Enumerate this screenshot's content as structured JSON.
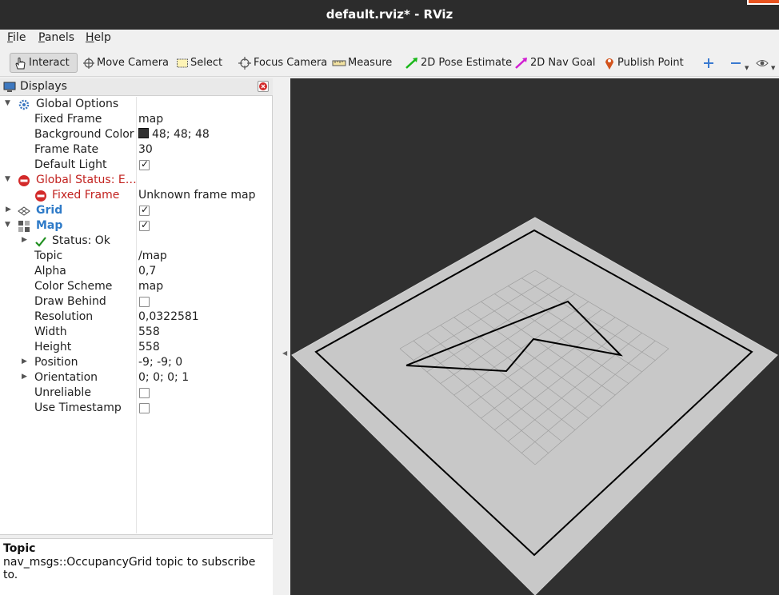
{
  "window": {
    "title": "default.rviz* - RViz"
  },
  "menu": [
    {
      "u": "F",
      "rest": "ile"
    },
    {
      "u": "P",
      "rest": "anels"
    },
    {
      "u": "H",
      "rest": "elp"
    }
  ],
  "toolbar": {
    "interact": "Interact",
    "move_camera": "Move Camera",
    "select": "Select",
    "focus_camera": "Focus Camera",
    "measure": "Measure",
    "pose_estimate": "2D Pose Estimate",
    "nav_goal": "2D Nav Goal",
    "publish_point": "Publish Point"
  },
  "displays": {
    "title": "Displays",
    "global_options": {
      "label": "Global Options",
      "fixed_frame": {
        "label": "Fixed Frame",
        "value": "map"
      },
      "background_color": {
        "label": "Background Color",
        "value": "48; 48; 48",
        "color": "#303030"
      },
      "frame_rate": {
        "label": "Frame Rate",
        "value": "30"
      },
      "default_light": {
        "label": "Default Light",
        "checked": true
      }
    },
    "global_status": {
      "label": "Global Status: E…",
      "fixed_frame": {
        "label": "Fixed Frame",
        "value": "Unknown frame map"
      }
    },
    "grid": {
      "label": "Grid",
      "checked": true
    },
    "map": {
      "label": "Map",
      "checked": true,
      "status": "Status: Ok",
      "topic": {
        "label": "Topic",
        "value": "/map"
      },
      "alpha": {
        "label": "Alpha",
        "value": "0,7"
      },
      "color_scheme": {
        "label": "Color Scheme",
        "value": "map"
      },
      "draw_behind": {
        "label": "Draw Behind",
        "checked": false
      },
      "resolution": {
        "label": "Resolution",
        "value": "0,0322581"
      },
      "width": {
        "label": "Width",
        "value": "558"
      },
      "height": {
        "label": "Height",
        "value": "558"
      },
      "position": {
        "label": "Position",
        "value": "-9; -9; 0"
      },
      "orientation": {
        "label": "Orientation",
        "value": "0; 0; 0; 1"
      },
      "unreliable": {
        "label": "Unreliable",
        "checked": false
      },
      "use_timestamp": {
        "label": "Use Timestamp",
        "checked": false
      }
    }
  },
  "help": {
    "title": "Topic",
    "description": "nav_msgs::OccupancyGrid topic to subscribe to."
  },
  "colors": {
    "viewport_bg": "#303030",
    "map_floor": "#c8c8c8",
    "wall": "#000000",
    "error": "#c2221f",
    "link": "#2f7bc8"
  }
}
